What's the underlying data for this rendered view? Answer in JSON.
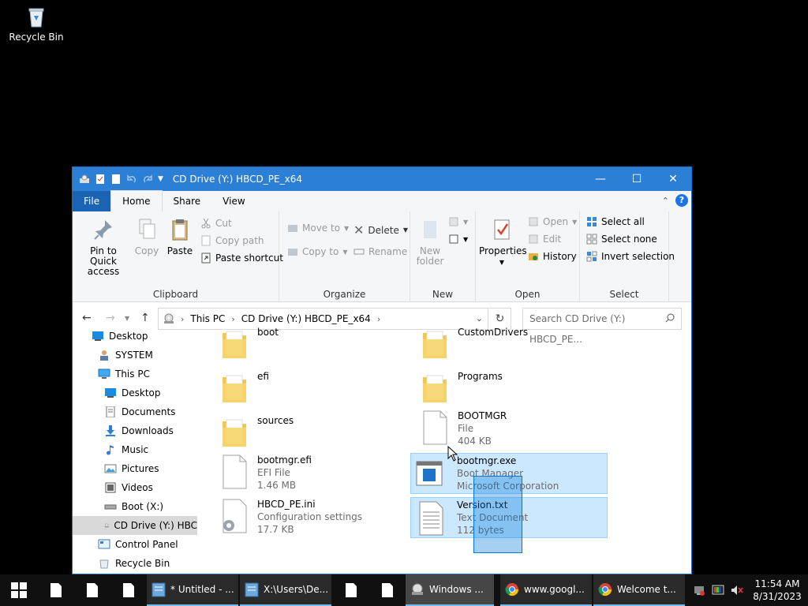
{
  "desktop": {
    "recycle_bin_label": "Recycle Bin"
  },
  "window": {
    "title": "CD Drive (Y:) HBCD_PE_x64",
    "minimize": "—",
    "maximize": "☐",
    "close": "✕"
  },
  "ribbon": {
    "tabs": {
      "file": "File",
      "home": "Home",
      "share": "Share",
      "view": "View"
    },
    "help": "?",
    "clipboard": {
      "label": "Clipboard",
      "pin_line1": "Pin to Quick",
      "pin_line2": "access",
      "copy": "Copy",
      "paste": "Paste",
      "cut": "Cut",
      "copy_path": "Copy path",
      "paste_shortcut": "Paste shortcut"
    },
    "organize": {
      "label": "Organize",
      "move_to": "Move to",
      "copy_to": "Copy to",
      "delete": "Delete",
      "rename": "Rename"
    },
    "new": {
      "label": "New",
      "new_folder_line1": "New",
      "new_folder_line2": "folder"
    },
    "open": {
      "label": "Open",
      "properties": "Properties",
      "open": "Open",
      "edit": "Edit",
      "history": "History"
    },
    "select": {
      "label": "Select",
      "select_all": "Select all",
      "select_none": "Select none",
      "invert": "Invert selection"
    }
  },
  "address": {
    "segments": [
      "This PC",
      "CD Drive (Y:) HBCD_PE_x64"
    ],
    "search_placeholder": "Search CD Drive (Y:) HBCD_PE..."
  },
  "navpane": {
    "items": [
      {
        "label": "Desktop"
      },
      {
        "label": "SYSTEM"
      },
      {
        "label": "This PC"
      },
      {
        "label": "Desktop"
      },
      {
        "label": "Documents"
      },
      {
        "label": "Downloads"
      },
      {
        "label": "Music"
      },
      {
        "label": "Pictures"
      },
      {
        "label": "Videos"
      },
      {
        "label": "Boot (X:)"
      },
      {
        "label": "CD Drive (Y:) HBC"
      },
      {
        "label": "Control Panel"
      },
      {
        "label": "Recycle Bin"
      }
    ]
  },
  "files": [
    {
      "name": "boot"
    },
    {
      "name": "CustomDrivers"
    },
    {
      "name": "efi"
    },
    {
      "name": "Programs"
    },
    {
      "name": "sources"
    },
    {
      "name": "BOOTMGR",
      "line1": "File",
      "line2": "404 KB"
    },
    {
      "name": "bootmgr.efi",
      "line1": "EFI File",
      "line2": "1.46 MB"
    },
    {
      "name": "bootmgr.exe",
      "line1": "Boot Manager",
      "line2": "Microsoft Corporation"
    },
    {
      "name": "HBCD_PE.ini",
      "line1": "Configuration settings",
      "line2": "17.7 KB"
    },
    {
      "name": "Version.txt",
      "line1": "Text Document",
      "line2": "112 bytes"
    }
  ],
  "taskbar": {
    "apps": [
      {
        "label": "* Untitled - ..."
      },
      {
        "label": "X:\\Users\\De..."
      },
      {
        "label": "Windows ..."
      },
      {
        "label": "www.googl..."
      },
      {
        "label": "Welcome t..."
      }
    ],
    "clock": {
      "time": "11:54 AM",
      "date": "8/31/2023"
    }
  },
  "colors": {
    "accent": "#2b7fd4",
    "selection": "#cce8ff",
    "folder": "#f3c74f"
  }
}
